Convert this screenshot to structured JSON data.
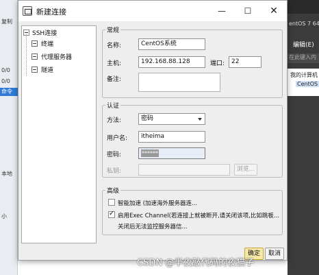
{
  "background": {
    "left_cells": [
      "复制",
      "0/0",
      "0/0",
      "命令",
      "本地",
      "小"
    ],
    "right_tab_title": "entOS 7 64",
    "edit_button": "编辑(E)",
    "search_placeholder": "在此键入内",
    "tree_root": "我的计算机",
    "tree_item": "CentOS"
  },
  "dialog": {
    "title": "新建连接",
    "controls": {
      "minimize": "—",
      "maximize": "☐",
      "close": "✕"
    }
  },
  "tree": {
    "root": "SSH连接",
    "children": [
      "终端",
      "代理服务器",
      "隧道"
    ]
  },
  "general": {
    "group_title": "常规",
    "name_label": "名称:",
    "name_value": "CentOS系统",
    "host_label": "主机:",
    "host_value": "192.168.88.128",
    "port_label": "端口:",
    "port_value": "22",
    "note_label": "备注:",
    "note_value": ""
  },
  "auth": {
    "group_title": "认证",
    "method_label": "方法:",
    "method_value": "密码",
    "user_label": "用户名:",
    "user_value": "itheima",
    "password_label": "密码:",
    "password_value": "******",
    "key_label": "私钥:",
    "key_value": "",
    "browse_label": "浏览..."
  },
  "advanced": {
    "group_title": "高级",
    "accel_label": "智能加速 (加速海外服务器连...",
    "accel_checked": false,
    "exec_label": "启用Exec Channel(若连接上就被断开,请关闭该项,比如跳板...",
    "exec_label_2": "关闭后无法监控服务器信...",
    "exec_checked": true
  },
  "buttons": {
    "ok": "确定",
    "cancel": "取消"
  },
  "watermark": "CSDN @半夜敲代码的夜猫子"
}
